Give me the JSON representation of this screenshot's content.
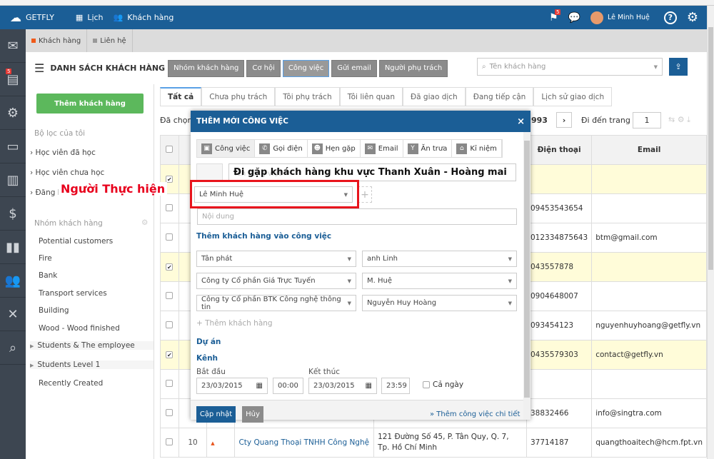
{
  "topbar": {
    "brand": "GETFLY",
    "nav": [
      {
        "label": "Lịch",
        "icon": "calendar-icon"
      },
      {
        "label": "Khách hàng",
        "icon": "users-icon"
      }
    ],
    "flag_badge": "5",
    "user": "Lê Minh Huệ"
  },
  "leftnav": {
    "items": [
      "mail-icon",
      "tasks-icon",
      "workflow-icon",
      "presentation-icon",
      "news-icon",
      "money-bag-icon",
      "library-icon",
      "contacts-icon",
      "network-icon",
      "search-icon"
    ],
    "tasks_badge": "5"
  },
  "subtabs": [
    {
      "label": "Khách hàng",
      "color": "#f05a1a"
    },
    {
      "label": "Liên hệ",
      "color": "#999999"
    }
  ],
  "header": {
    "title": "DANH SÁCH KHÁCH HÀNG",
    "buttons": [
      "Nhóm khách hàng",
      "Cơ hội",
      "Công việc",
      "Gửi email",
      "Người phụ trách"
    ],
    "active": "Công việc",
    "search_placeholder": "Tên khách hàng"
  },
  "sidebar": {
    "add_button": "Thêm khách hàng",
    "filters_title": "Bộ lọc của tôi",
    "filters": [
      "Học viên đã học",
      "Học viên chưa học",
      "Đăng k"
    ],
    "groups_title": "Nhóm khách hàng",
    "groups": [
      "Potential customers",
      "Fire",
      "Bank",
      "Transport services",
      "Building",
      "Wood - Wood finished",
      "Students & The employee",
      "Students Level 1",
      "Recently Created"
    ]
  },
  "tabs": [
    "Tất cả",
    "Chưa phụ trách",
    "Tôi phụ trách",
    "Tôi liên quan",
    "Đã giao dịch",
    "Đang tiếp cận",
    "Lịch sử giao dịch"
  ],
  "pager": {
    "selected_prefix": "Đã chọn",
    "total": "993",
    "goto_label": "Đi đến trang",
    "page": "1"
  },
  "table": {
    "headers": {
      "stt": "S",
      "phone": "Điện thoại",
      "email": "Email"
    },
    "rows": [
      {
        "checked": true,
        "phone": "",
        "email": ""
      },
      {
        "checked": false,
        "phone": "09453543654",
        "email": ""
      },
      {
        "checked": false,
        "phone": "012334875643",
        "email": "btm@gmail.com"
      },
      {
        "checked": true,
        "phone": "043557878",
        "email": ""
      },
      {
        "checked": false,
        "phone": "0904648007",
        "email": ""
      },
      {
        "checked": false,
        "phone": "093454123",
        "email": "nguyenhuyhoang@getfly.vn"
      },
      {
        "checked": true,
        "phone": "0435579303",
        "email": "contact@getfly.vn"
      },
      {
        "checked": false,
        "phone": "",
        "email": ""
      },
      {
        "checked": false,
        "phone": "38832466",
        "email": "info@singtra.com"
      },
      {
        "checked": false,
        "stt": "10",
        "name": "Cty Quang Thoại TNHH Công Nghệ",
        "address": "121 Đường Số 45, P. Tân Quy, Q. 7, Tp. Hồ Chí Minh",
        "phone": "37714187",
        "email": "quangthoaitech@hcm.fpt.vn"
      }
    ]
  },
  "modal": {
    "title": "THÊM MỚI CÔNG VIỆC",
    "types": [
      "Công việc",
      "Gọi điện",
      "Hẹn gặp",
      "Email",
      "Ăn trưa",
      "Kỉ niệm"
    ],
    "task_name": "Đi gặp khách hàng khu vực Thanh Xuân - Hoàng mai",
    "task_name_placeholder": "Tên công việc",
    "assignee": "Lê Minh Huệ",
    "content_placeholder": "Nội dung",
    "add_customer_title": "Thêm khách hàng vào công việc",
    "customers": [
      {
        "company": "Tân phát",
        "contact": "anh Linh"
      },
      {
        "company": "Công ty Cổ phần Giá Trực Tuyến",
        "contact": "M. Huệ"
      },
      {
        "company": "Công ty Cổ phần BTK Công nghệ thông tin",
        "contact": "Nguyễn Huy Hoàng"
      }
    ],
    "add_customer_link": "Thêm khách hàng",
    "project_label": "Dự án",
    "channel_label": "Kênh",
    "start_label": "Bắt đầu",
    "end_label": "Kết thúc",
    "start_date": "23/03/2015",
    "start_time": "00:00",
    "end_date": "23/03/2015",
    "end_time": "23:59",
    "all_day": "Cả ngày",
    "save": "Cập nhật",
    "cancel": "Hủy",
    "detail_link": "» Thêm công việc chi tiết"
  },
  "annotation": {
    "label": "Người Thực hiện",
    "color": "#e8141c"
  }
}
